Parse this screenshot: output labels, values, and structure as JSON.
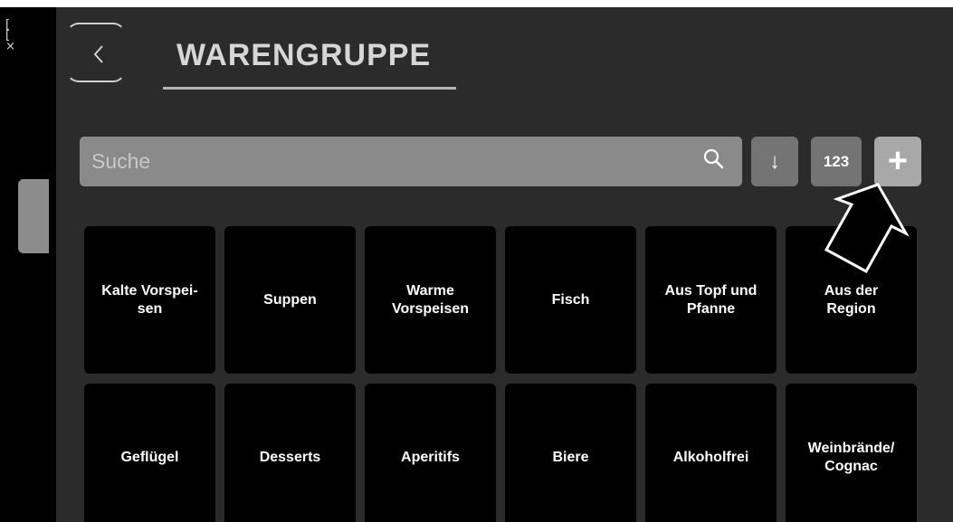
{
  "header": {
    "title": "WARENGRUPPE",
    "back_label": "<"
  },
  "left_strip": {
    "glyph": "[ \n[ \n×"
  },
  "search": {
    "placeholder": "Suche"
  },
  "toolbar": {
    "sort_label": "↓",
    "numeric_label": "123",
    "add_label": "+"
  },
  "categories": [
    {
      "label": "Kalte Vorspei-\nsen"
    },
    {
      "label": "Suppen"
    },
    {
      "label": "Warme\nVorspeisen"
    },
    {
      "label": "Fisch"
    },
    {
      "label": "Aus Topf und\nPfanne"
    },
    {
      "label": "Aus der\nRegion"
    },
    {
      "label": "Geflügel"
    },
    {
      "label": "Desserts"
    },
    {
      "label": "Aperitifs"
    },
    {
      "label": "Biere"
    },
    {
      "label": "Alkoholfrei"
    },
    {
      "label": "Weinbrände/\nCognac"
    }
  ],
  "colors": {
    "background": "#2b2b2b",
    "tile": "#000000",
    "search_bar": "#8a8a8a",
    "add_button": "#a8a8a8"
  },
  "icons": {
    "search": "search-icon",
    "back": "chevron-left-icon",
    "pointer": "arrow-pointer-icon"
  }
}
